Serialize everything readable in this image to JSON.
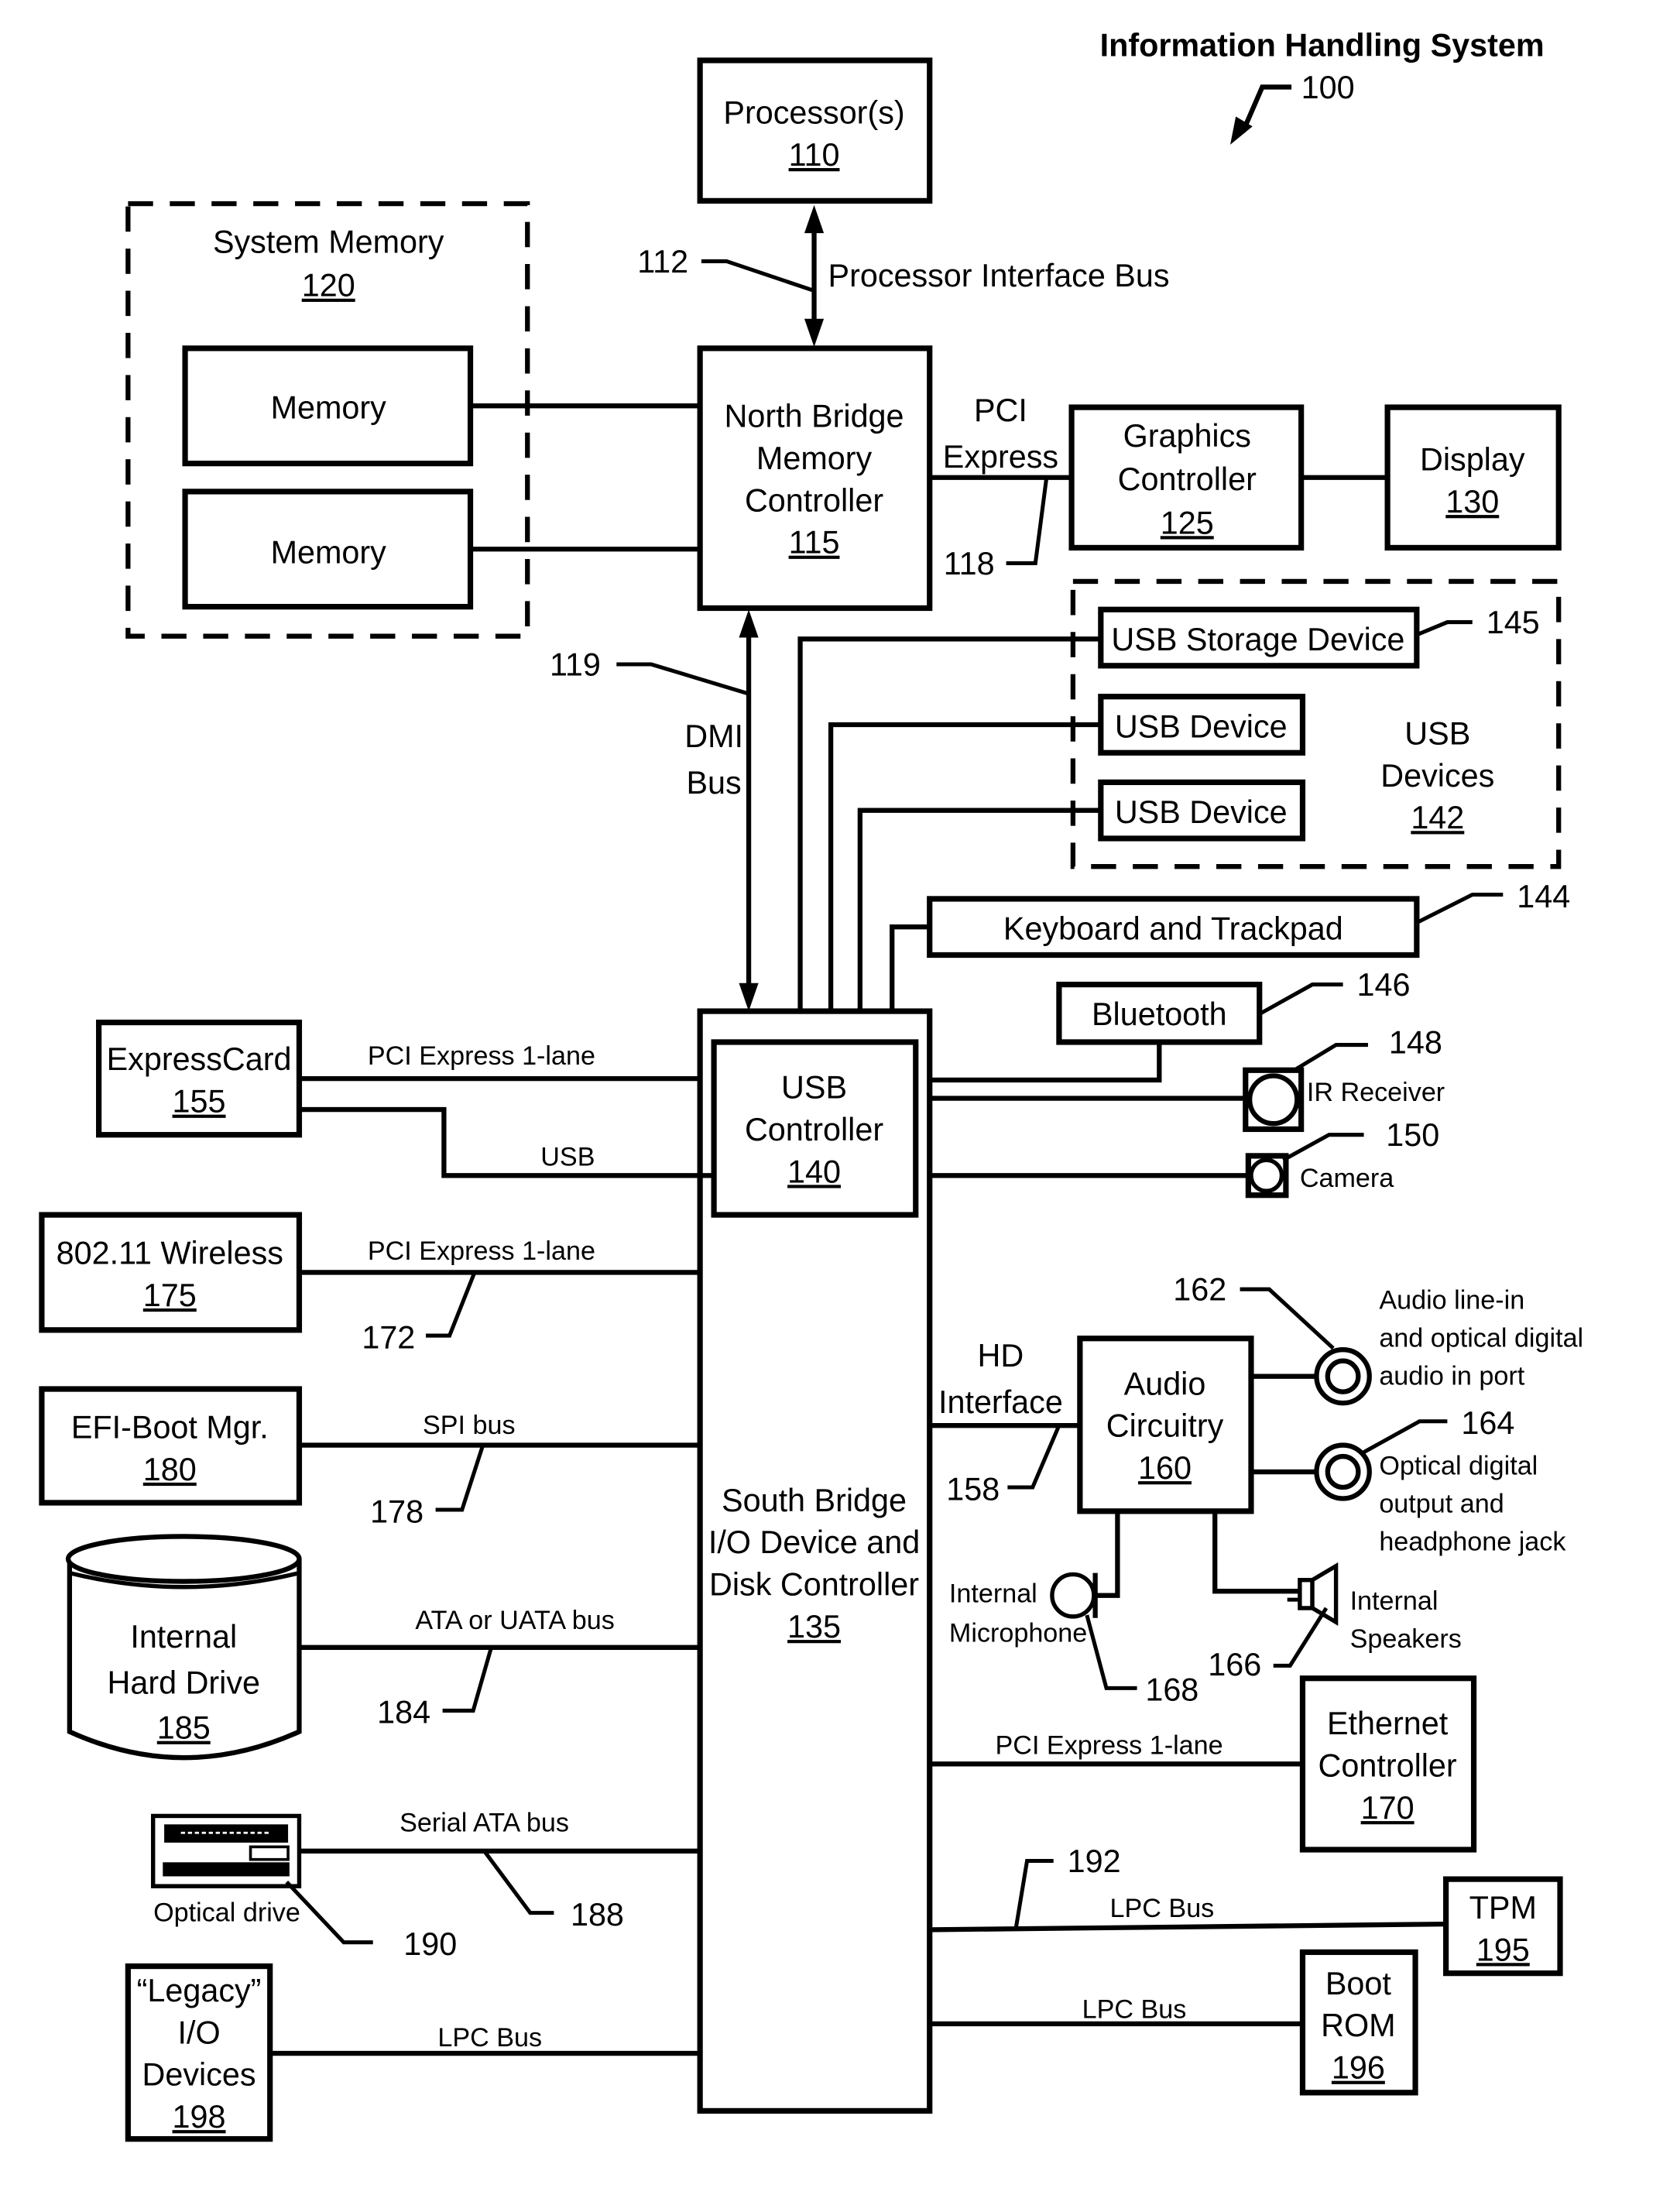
{
  "title": "Information Handling System",
  "title_ref": "100",
  "processor": {
    "label": "Processor(s)",
    "ref": "110"
  },
  "processor_bus": {
    "label": "Processor Interface Bus",
    "ref": "112"
  },
  "system_memory": {
    "label": "System Memory",
    "ref": "120",
    "modules": [
      "Memory",
      "Memory"
    ]
  },
  "north_bridge": {
    "lines": [
      "North Bridge",
      "Memory",
      "Controller"
    ],
    "ref": "115"
  },
  "pci_express_link": {
    "lines": [
      "PCI",
      "Express"
    ],
    "ref": "118"
  },
  "graphics": {
    "lines": [
      "Graphics",
      "Controller"
    ],
    "ref": "125"
  },
  "display": {
    "label": "Display",
    "ref": "130"
  },
  "dmi_bus": {
    "lines": [
      "DMI",
      "Bus"
    ],
    "ref": "119"
  },
  "usb_devices": {
    "lines": [
      "USB",
      "Devices"
    ],
    "ref": "142",
    "storage": {
      "label": "USB Storage Device",
      "ref": "145"
    },
    "device_1": "USB Device",
    "device_2": "USB Device"
  },
  "keyboard": {
    "label": "Keyboard and Trackpad",
    "ref": "144"
  },
  "bluetooth": {
    "label": "Bluetooth",
    "ref": "146"
  },
  "ir_receiver": {
    "label": "IR Receiver",
    "ref": "148"
  },
  "camera": {
    "label": "Camera",
    "ref": "150"
  },
  "usb_controller": {
    "lines": [
      "USB",
      "Controller"
    ],
    "ref": "140"
  },
  "south_bridge": {
    "lines": [
      "South Bridge",
      "I/O Device and",
      "Disk Controller"
    ],
    "ref": "135"
  },
  "expresscard": {
    "label": "ExpressCard",
    "ref": "155",
    "bus_1": "PCI Express 1-lane",
    "bus_2": "USB"
  },
  "wireless": {
    "label": "802.11 Wireless",
    "ref": "175",
    "bus": "PCI Express 1-lane",
    "bus_ref": "172"
  },
  "efi_boot": {
    "label": "EFI-Boot Mgr.",
    "ref": "180",
    "bus": "SPI bus",
    "bus_ref": "178"
  },
  "hard_drive": {
    "lines": [
      "Internal",
      "Hard Drive"
    ],
    "ref": "185",
    "bus": "ATA or UATA bus",
    "bus_ref": "184"
  },
  "optical_drive": {
    "label": "Optical drive",
    "ref": "190",
    "bus": "Serial ATA bus",
    "bus_ref": "188"
  },
  "legacy_io": {
    "lines": [
      "“Legacy”",
      "I/O",
      "Devices"
    ],
    "ref": "198",
    "bus": "LPC Bus"
  },
  "hd_interface": {
    "lines": [
      "HD",
      "Interface"
    ],
    "ref": "158"
  },
  "audio": {
    "lines": [
      "Audio",
      "Circuitry"
    ],
    "ref": "160"
  },
  "audio_line_in": {
    "lines": [
      "Audio line-in",
      "and optical digital",
      "audio in port"
    ],
    "ref": "162"
  },
  "optical_out": {
    "lines": [
      "Optical digital",
      "output and",
      "headphone jack"
    ],
    "ref": "164"
  },
  "speakers": {
    "lines": [
      "Internal",
      "Speakers"
    ],
    "ref": "166"
  },
  "microphone": {
    "lines": [
      "Internal",
      "Microphone"
    ],
    "ref": "168"
  },
  "ethernet": {
    "lines": [
      "Ethernet",
      "Controller"
    ],
    "ref": "170",
    "bus": "PCI Express 1-lane"
  },
  "tpm": {
    "label": "TPM",
    "ref": "195",
    "bus": "LPC Bus",
    "bus_ref": "192"
  },
  "boot_rom": {
    "lines": [
      "Boot",
      "ROM"
    ],
    "ref": "196",
    "bus": "LPC Bus"
  }
}
